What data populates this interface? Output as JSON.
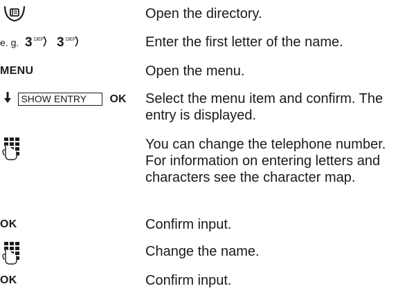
{
  "steps": [
    {
      "key": "",
      "text": "Open the directory."
    },
    {
      "key": "e. g.",
      "keys": [
        "3",
        "3"
      ],
      "key_sub": "DEF",
      "text": "Enter the first letter of the name."
    },
    {
      "key": "MENU",
      "text": "Open the menu."
    },
    {
      "menu_item": "SHOW ENTRY",
      "ok": "OK",
      "text": "Select the menu item and confirm. The entry is displayed."
    },
    {
      "key": "",
      "text": "You can change the telephone number. For information on entering letters and characters see the character map."
    },
    {
      "key": "OK",
      "text": "Confirm input."
    },
    {
      "key": "",
      "text": "Change the name."
    },
    {
      "key": "OK",
      "text": "Confirm input."
    }
  ],
  "icons": [
    "directory-key-icon",
    "keypad-icon",
    "arrow-down-icon"
  ]
}
